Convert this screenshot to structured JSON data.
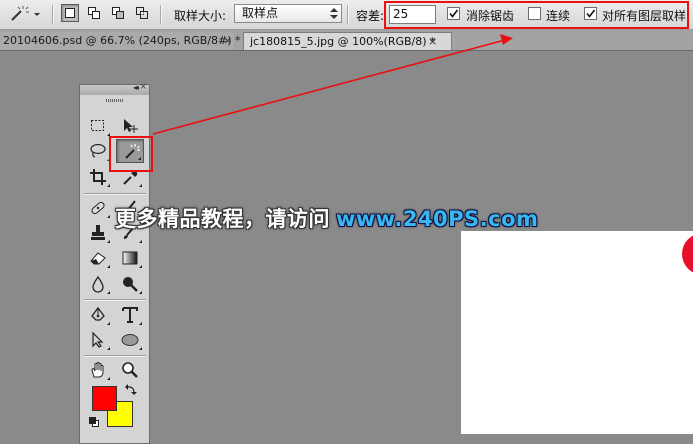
{
  "options_bar": {
    "sample_size_label": "取样大小:",
    "sample_size_value": "取样点",
    "tolerance_label": "容差:",
    "tolerance_value": "25",
    "anti_alias_label": "消除锯齿",
    "anti_alias_checked": true,
    "contiguous_label": "连续",
    "contiguous_checked": false,
    "sample_all_layers_label": "对所有图层取样",
    "sample_all_layers_checked": true
  },
  "tabs": [
    {
      "label": "20104606.psd @ 66.7% (240ps, RGB/8#) *",
      "close": "×",
      "active": false
    },
    {
      "label": "jc180815_5.jpg @ 100%(RGB/8) *",
      "close": "×",
      "active": true
    }
  ],
  "tools_panel": {
    "collapse_glyph": "◂◂",
    "close_glyph": "×",
    "selected_tool": "magic-wand-tool"
  },
  "colors": {
    "foreground": "#ff0000",
    "background": "#ffff00",
    "highlight": "#e81010"
  },
  "watermark": {
    "chinese": "更多精品教程，请访问",
    "url": "www.240PS.com"
  }
}
